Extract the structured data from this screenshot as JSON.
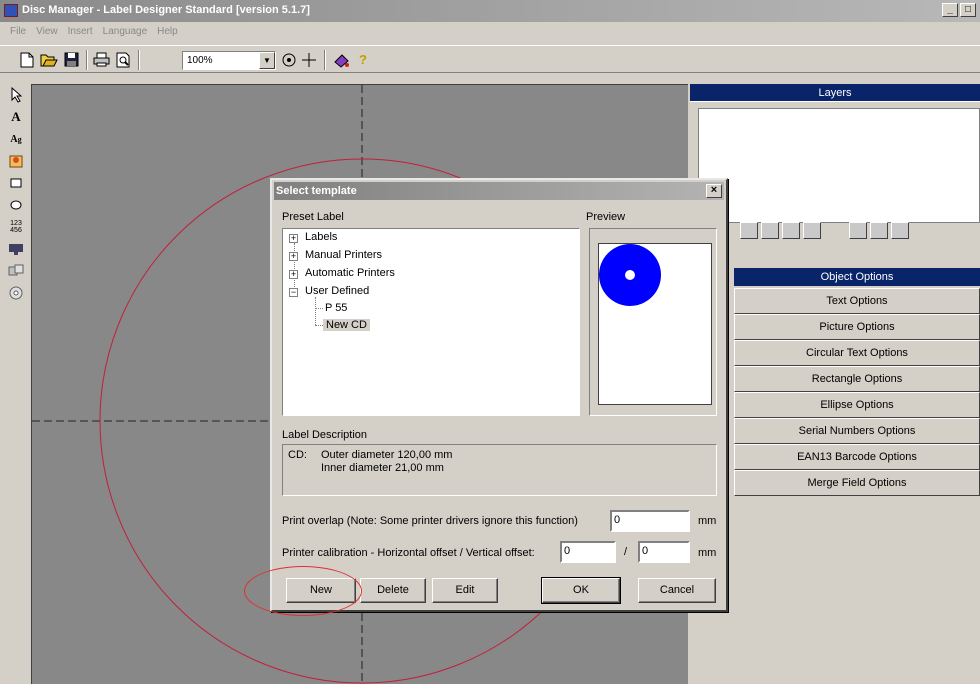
{
  "window": {
    "title": "Disc Manager - Label Designer Standard   [version 5.1.7]",
    "min": "_",
    "max": "□"
  },
  "menu": [
    "File",
    "View",
    "Insert",
    "Language",
    "Help"
  ],
  "toolbar": {
    "zoom_value": "100%",
    "icons": [
      "new-icon",
      "open-icon",
      "save-icon",
      "print-icon",
      "print-preview-icon",
      "snap-icon",
      "crosshair-icon",
      "paint-icon",
      "help-icon"
    ]
  },
  "left_tools": [
    "pointer-tool",
    "text-tool",
    "circular-text-tool",
    "picture-tool",
    "rectangle-tool",
    "ellipse-tool",
    "serial-tool",
    "barcode-tool",
    "merge-tool",
    "cd-tool"
  ],
  "right_panel": {
    "layers_title": "Layers",
    "options": [
      "Object Options",
      "Text Options",
      "Picture Options",
      "Circular Text Options",
      "Rectangle Options",
      "Ellipse Options",
      "Serial Numbers Options",
      "EAN13 Barcode Options",
      "Merge Field Options"
    ]
  },
  "dialog": {
    "title": "Select template",
    "close": "×",
    "preset_label": "Preset Label",
    "preview_label": "Preview",
    "tree": {
      "labels": "Labels",
      "manual_printers": "Manual Printers",
      "automatic_printers": "Automatic Printers",
      "user_defined": "User Defined",
      "p55": "P 55",
      "new_cd": "New CD"
    },
    "expand": "+",
    "collapse": "−",
    "label_description_title": "Label Description",
    "description": {
      "type": "CD:",
      "outer": "Outer diameter 120,00 mm",
      "inner": "Inner diameter 21,00 mm"
    },
    "print_overlap_label": "Print overlap  (Note: Some printer drivers ignore this function)",
    "print_overlap_value": "0",
    "unit_mm": "mm",
    "calibration_label": "Printer calibration - Horizontal offset / Vertical offset:",
    "horizontal_offset": "0",
    "offset_separator": "/",
    "vertical_offset": "0",
    "buttons": {
      "new": "New",
      "delete": "Delete",
      "edit": "Edit",
      "ok": "OK",
      "cancel": "Cancel"
    }
  },
  "colors": {
    "preview_disc": "#0000ff",
    "annotation": "#e03030",
    "guide_circle": "#c0203a"
  }
}
